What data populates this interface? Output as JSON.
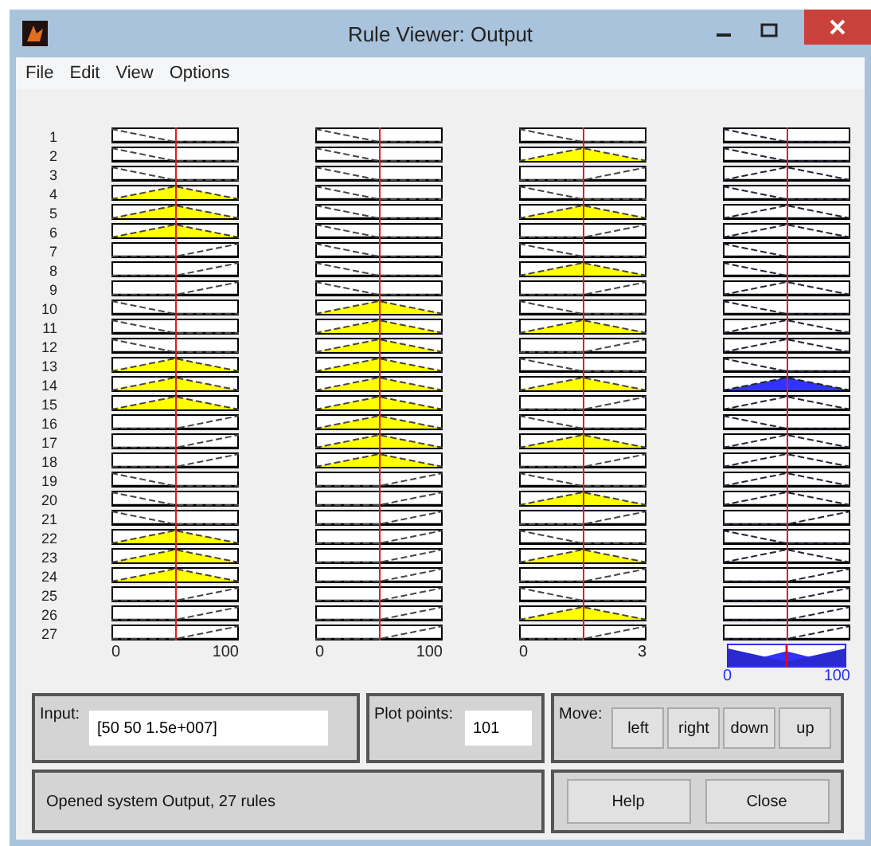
{
  "window": {
    "title": "Rule Viewer: Output"
  },
  "menu": [
    "File",
    "Edit",
    "View",
    "Options"
  ],
  "columns": [
    {
      "kind": "input",
      "min": "0",
      "max": "100"
    },
    {
      "kind": "input",
      "min": "0",
      "max": "100"
    },
    {
      "kind": "input",
      "min": "0",
      "max": "3"
    },
    {
      "kind": "output",
      "min": "0",
      "max": "100"
    }
  ],
  "rules": [
    {
      "number": "1",
      "cells": [
        {
          "kind": "low",
          "fired": false
        },
        {
          "kind": "low",
          "fired": false
        },
        {
          "kind": "low",
          "fired": false
        },
        {
          "kind": "low",
          "fired": false
        }
      ]
    },
    {
      "number": "2",
      "cells": [
        {
          "kind": "low",
          "fired": false
        },
        {
          "kind": "low",
          "fired": false
        },
        {
          "kind": "mid",
          "fired": true
        },
        {
          "kind": "low",
          "fired": false
        }
      ]
    },
    {
      "number": "3",
      "cells": [
        {
          "kind": "low",
          "fired": false
        },
        {
          "kind": "low",
          "fired": false
        },
        {
          "kind": "high",
          "fired": false
        },
        {
          "kind": "mid",
          "fired": false
        }
      ]
    },
    {
      "number": "4",
      "cells": [
        {
          "kind": "mid",
          "fired": true
        },
        {
          "kind": "low",
          "fired": false
        },
        {
          "kind": "low",
          "fired": false
        },
        {
          "kind": "low",
          "fired": false
        }
      ]
    },
    {
      "number": "5",
      "cells": [
        {
          "kind": "mid",
          "fired": true
        },
        {
          "kind": "low",
          "fired": false
        },
        {
          "kind": "mid",
          "fired": true
        },
        {
          "kind": "mid",
          "fired": false
        }
      ]
    },
    {
      "number": "6",
      "cells": [
        {
          "kind": "mid",
          "fired": true
        },
        {
          "kind": "low",
          "fired": false
        },
        {
          "kind": "high",
          "fired": false
        },
        {
          "kind": "mid",
          "fired": false
        }
      ]
    },
    {
      "number": "7",
      "cells": [
        {
          "kind": "high",
          "fired": false
        },
        {
          "kind": "low",
          "fired": false
        },
        {
          "kind": "low",
          "fired": false
        },
        {
          "kind": "low",
          "fired": false
        }
      ]
    },
    {
      "number": "8",
      "cells": [
        {
          "kind": "high",
          "fired": false
        },
        {
          "kind": "low",
          "fired": false
        },
        {
          "kind": "mid",
          "fired": true
        },
        {
          "kind": "low",
          "fired": false
        }
      ]
    },
    {
      "number": "9",
      "cells": [
        {
          "kind": "high",
          "fired": false
        },
        {
          "kind": "low",
          "fired": false
        },
        {
          "kind": "high",
          "fired": false
        },
        {
          "kind": "mid",
          "fired": false
        }
      ]
    },
    {
      "number": "10",
      "cells": [
        {
          "kind": "low",
          "fired": false
        },
        {
          "kind": "mid",
          "fired": true
        },
        {
          "kind": "low",
          "fired": false
        },
        {
          "kind": "low",
          "fired": false
        }
      ]
    },
    {
      "number": "11",
      "cells": [
        {
          "kind": "low",
          "fired": false
        },
        {
          "kind": "mid",
          "fired": true
        },
        {
          "kind": "mid",
          "fired": true
        },
        {
          "kind": "mid",
          "fired": false
        }
      ]
    },
    {
      "number": "12",
      "cells": [
        {
          "kind": "low",
          "fired": false
        },
        {
          "kind": "mid",
          "fired": true
        },
        {
          "kind": "high",
          "fired": false
        },
        {
          "kind": "mid",
          "fired": false
        }
      ]
    },
    {
      "number": "13",
      "cells": [
        {
          "kind": "mid",
          "fired": true
        },
        {
          "kind": "mid",
          "fired": true
        },
        {
          "kind": "low",
          "fired": false
        },
        {
          "kind": "low",
          "fired": false
        }
      ]
    },
    {
      "number": "14",
      "cells": [
        {
          "kind": "mid",
          "fired": true
        },
        {
          "kind": "mid",
          "fired": true
        },
        {
          "kind": "mid",
          "fired": true
        },
        {
          "kind": "mid",
          "fired": true
        }
      ]
    },
    {
      "number": "15",
      "cells": [
        {
          "kind": "mid",
          "fired": true
        },
        {
          "kind": "mid",
          "fired": true
        },
        {
          "kind": "high",
          "fired": false
        },
        {
          "kind": "mid",
          "fired": false
        }
      ]
    },
    {
      "number": "16",
      "cells": [
        {
          "kind": "high",
          "fired": false
        },
        {
          "kind": "mid",
          "fired": true
        },
        {
          "kind": "low",
          "fired": false
        },
        {
          "kind": "low",
          "fired": false
        }
      ]
    },
    {
      "number": "17",
      "cells": [
        {
          "kind": "high",
          "fired": false
        },
        {
          "kind": "mid",
          "fired": true
        },
        {
          "kind": "mid",
          "fired": true
        },
        {
          "kind": "mid",
          "fired": false
        }
      ]
    },
    {
      "number": "18",
      "cells": [
        {
          "kind": "high",
          "fired": false
        },
        {
          "kind": "mid",
          "fired": true
        },
        {
          "kind": "high",
          "fired": false
        },
        {
          "kind": "mid",
          "fired": false
        }
      ]
    },
    {
      "number": "19",
      "cells": [
        {
          "kind": "low",
          "fired": false
        },
        {
          "kind": "high",
          "fired": false
        },
        {
          "kind": "low",
          "fired": false
        },
        {
          "kind": "mid",
          "fired": false
        }
      ]
    },
    {
      "number": "20",
      "cells": [
        {
          "kind": "low",
          "fired": false
        },
        {
          "kind": "high",
          "fired": false
        },
        {
          "kind": "mid",
          "fired": true
        },
        {
          "kind": "mid",
          "fired": false
        }
      ]
    },
    {
      "number": "21",
      "cells": [
        {
          "kind": "low",
          "fired": false
        },
        {
          "kind": "high",
          "fired": false
        },
        {
          "kind": "high",
          "fired": false
        },
        {
          "kind": "high",
          "fired": false
        }
      ]
    },
    {
      "number": "22",
      "cells": [
        {
          "kind": "mid",
          "fired": true
        },
        {
          "kind": "high",
          "fired": false
        },
        {
          "kind": "low",
          "fired": false
        },
        {
          "kind": "low",
          "fired": false
        }
      ]
    },
    {
      "number": "23",
      "cells": [
        {
          "kind": "mid",
          "fired": true
        },
        {
          "kind": "high",
          "fired": false
        },
        {
          "kind": "mid",
          "fired": true
        },
        {
          "kind": "mid",
          "fired": false
        }
      ]
    },
    {
      "number": "24",
      "cells": [
        {
          "kind": "mid",
          "fired": true
        },
        {
          "kind": "high",
          "fired": false
        },
        {
          "kind": "high",
          "fired": false
        },
        {
          "kind": "high",
          "fired": false
        }
      ]
    },
    {
      "number": "25",
      "cells": [
        {
          "kind": "high",
          "fired": false
        },
        {
          "kind": "high",
          "fired": false
        },
        {
          "kind": "low",
          "fired": false
        },
        {
          "kind": "high",
          "fired": false
        }
      ]
    },
    {
      "number": "26",
      "cells": [
        {
          "kind": "high",
          "fired": false
        },
        {
          "kind": "high",
          "fired": false
        },
        {
          "kind": "mid",
          "fired": true
        },
        {
          "kind": "high",
          "fired": false
        }
      ]
    },
    {
      "number": "27",
      "cells": [
        {
          "kind": "high",
          "fired": false
        },
        {
          "kind": "high",
          "fired": false
        },
        {
          "kind": "high",
          "fired": false
        },
        {
          "kind": "high",
          "fired": false
        }
      ]
    }
  ],
  "input": {
    "label": "Input:",
    "value": "[50 50 1.5e+007]"
  },
  "plot_points": {
    "label": "Plot points:",
    "value": "101"
  },
  "move": {
    "label": "Move:",
    "buttons": [
      "left",
      "right",
      "down",
      "up"
    ]
  },
  "status": "Opened system Output, 27 rules",
  "buttons": [
    "Help",
    "Close"
  ]
}
